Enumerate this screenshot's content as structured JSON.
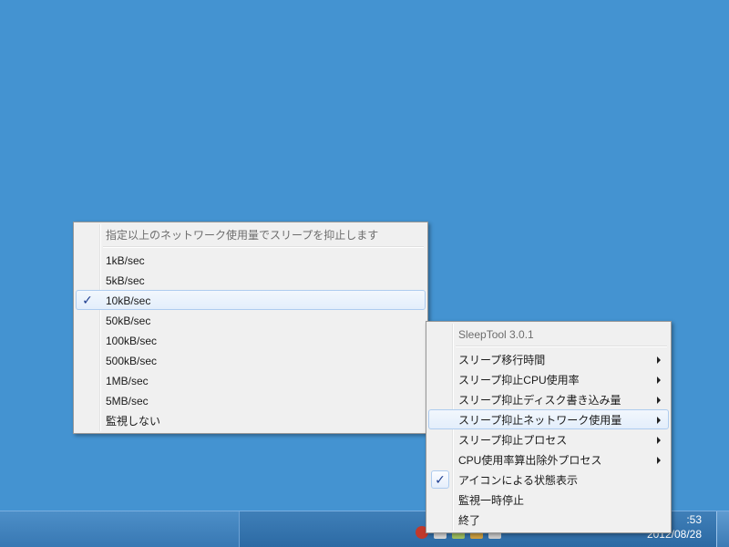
{
  "submenu": {
    "header": "指定以上のネットワーク使用量でスリープを抑止します",
    "items": [
      {
        "label": "1kB/sec",
        "checked": false
      },
      {
        "label": "5kB/sec",
        "checked": false
      },
      {
        "label": "10kB/sec",
        "checked": true
      },
      {
        "label": "50kB/sec",
        "checked": false
      },
      {
        "label": "100kB/sec",
        "checked": false
      },
      {
        "label": "500kB/sec",
        "checked": false
      },
      {
        "label": "1MB/sec",
        "checked": false
      },
      {
        "label": "5MB/sec",
        "checked": false
      },
      {
        "label": "監視しない",
        "checked": false
      }
    ],
    "check_glyph": "✓"
  },
  "mainmenu": {
    "header": "SleepTool 3.0.1",
    "items": [
      {
        "label": "スリープ移行時間",
        "submenu": true
      },
      {
        "label": "スリープ抑止CPU使用率",
        "submenu": true
      },
      {
        "label": "スリープ抑止ディスク書き込み量",
        "submenu": true
      },
      {
        "label": "スリープ抑止ネットワーク使用量",
        "submenu": true
      },
      {
        "label": "スリープ抑止プロセス",
        "submenu": true
      },
      {
        "label": "CPU使用率算出除外プロセス",
        "submenu": true
      },
      {
        "label": "アイコンによる状態表示",
        "checked": true
      },
      {
        "label": "監視一時停止"
      },
      {
        "label": "終了"
      }
    ],
    "check_glyph": "✓"
  },
  "taskbar": {
    "clock_time": ":53",
    "clock_date": "2012/08/28"
  },
  "colors": {
    "desktop": "#4493d1",
    "menu_bg": "#f0f0f0",
    "check": "#1e3d8f"
  }
}
